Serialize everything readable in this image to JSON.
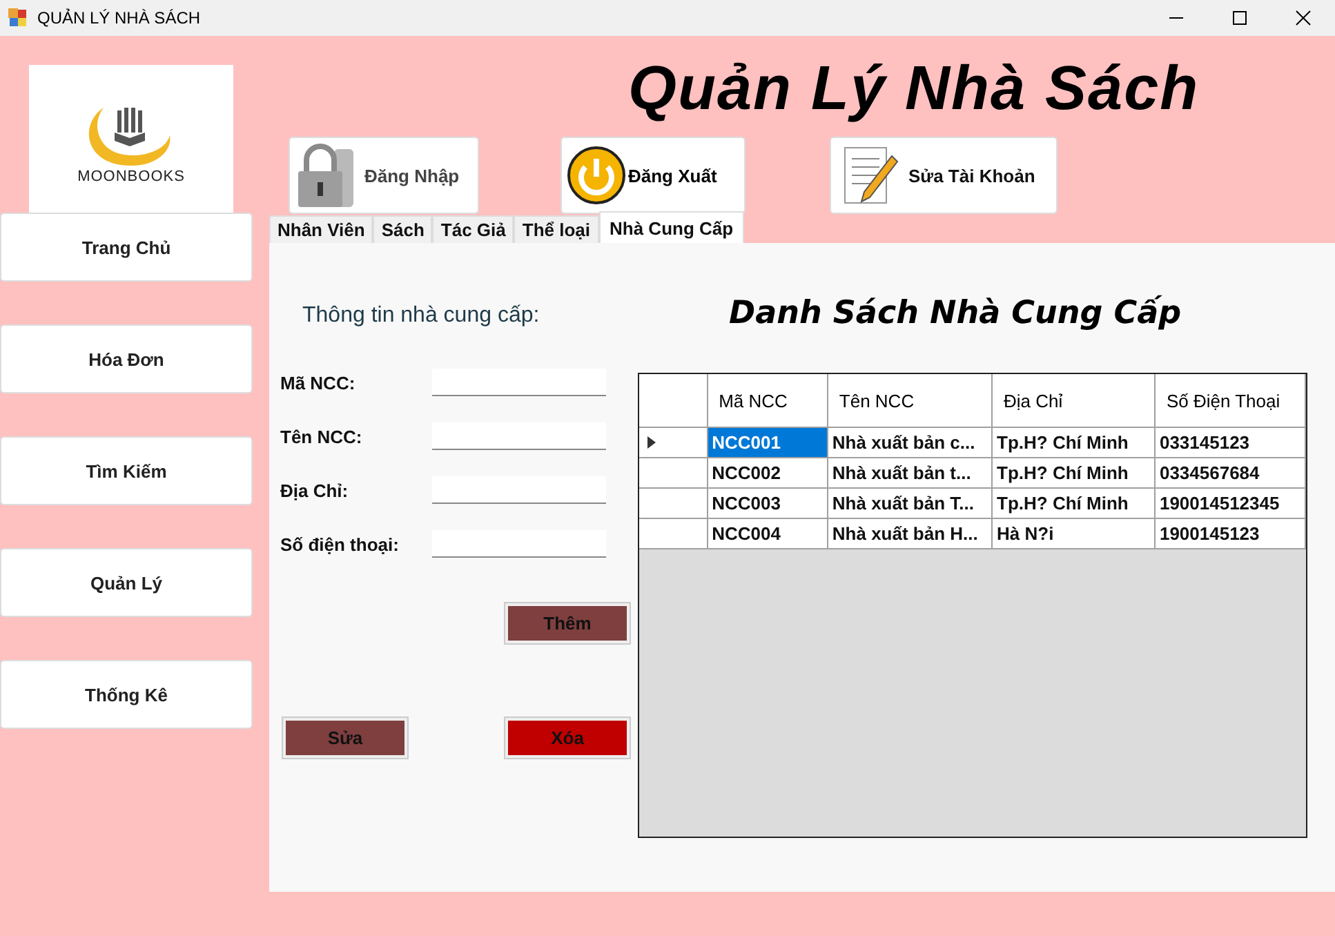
{
  "window": {
    "title": "QUẢN LÝ NHÀ SÁCH"
  },
  "logo": {
    "text": "MOONBOOKS"
  },
  "header": {
    "title": "Quản Lý Nhà Sách"
  },
  "top_buttons": [
    {
      "kind": "login",
      "label": "Đăng Nhập"
    },
    {
      "kind": "logout",
      "label": "Đăng Xuất"
    },
    {
      "kind": "edit",
      "label": "Sửa Tài Khoản"
    }
  ],
  "nav": [
    "Trang Chủ",
    "Hóa Đơn",
    "Tìm Kiếm",
    "Quản Lý",
    "Thống Kê"
  ],
  "tabs": [
    {
      "label": "Nhân Viên",
      "selected": false
    },
    {
      "label": "Sách",
      "selected": false
    },
    {
      "label": "Tác Giả",
      "selected": false
    },
    {
      "label": "Thể loại",
      "selected": false
    },
    {
      "label": "Nhà Cung Cấp",
      "selected": true
    }
  ],
  "form": {
    "title": "Thông tin nhà cung cấp:",
    "fields": [
      "Mã NCC:",
      "Tên NCC:",
      "Địa Chỉ:",
      "Số điện thoại:"
    ]
  },
  "actions": [
    {
      "label": "Thêm",
      "color": "#7f3f3f"
    },
    {
      "label": "Sửa",
      "color": "#7f3f3f"
    },
    {
      "label": "Xóa",
      "color": "#c00000"
    }
  ],
  "grid": {
    "title": "Danh Sách Nhà Cung Cấp",
    "columns": [
      "Mã NCC",
      "Tên NCC",
      "Địa Chỉ",
      "Số Điện Thoại"
    ],
    "rows": [
      {
        "selected": true,
        "cells": [
          "NCC001",
          "Nhà xuất bản c...",
          "Tp.H? Chí Minh",
          "033145123"
        ]
      },
      {
        "selected": false,
        "cells": [
          "NCC002",
          "Nhà xuất bản t...",
          "Tp.H? Chí Minh",
          "0334567684"
        ]
      },
      {
        "selected": false,
        "cells": [
          "NCC003",
          "Nhà xuất bản T...",
          "Tp.H? Chí Minh",
          "190014512345"
        ]
      },
      {
        "selected": false,
        "cells": [
          "NCC004",
          "Nhà xuất bản H...",
          "Hà N?i",
          "1900145123"
        ]
      }
    ]
  }
}
